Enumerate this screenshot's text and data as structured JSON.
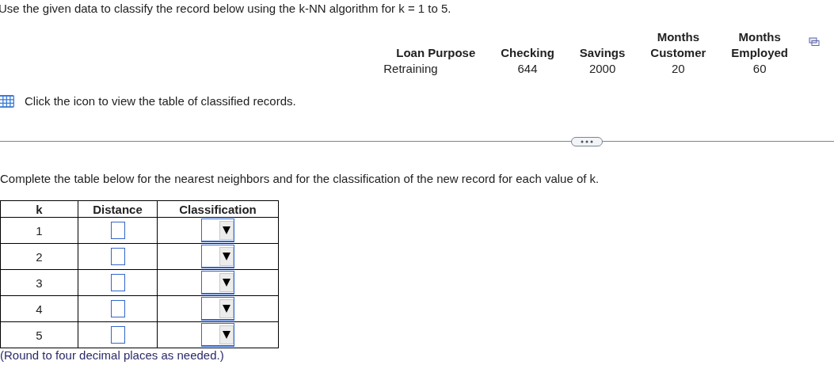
{
  "instruction": "Use the given data to classify the record below using the k-NN algorithm for k = 1 to 5.",
  "record": {
    "columns": [
      {
        "label": "Loan Purpose",
        "value": "Retraining"
      },
      {
        "label": "Checking",
        "value": "644"
      },
      {
        "label": "Savings",
        "value": "2000"
      },
      {
        "label": "Months Customer",
        "value": "20"
      },
      {
        "label": "Months Employed",
        "value": "60"
      }
    ]
  },
  "table_link": "Click the icon to view the table of classified records.",
  "prompt": "Complete the table below for the nearest neighbors and for the classification of the new record for each value of k.",
  "answer_table": {
    "columns": [
      "k",
      "Distance",
      "Classification"
    ],
    "rows": [
      {
        "k": "1"
      },
      {
        "k": "2"
      },
      {
        "k": "3"
      },
      {
        "k": "4"
      },
      {
        "k": "5"
      }
    ]
  },
  "note": "(Round to four decimal places as needed.)"
}
